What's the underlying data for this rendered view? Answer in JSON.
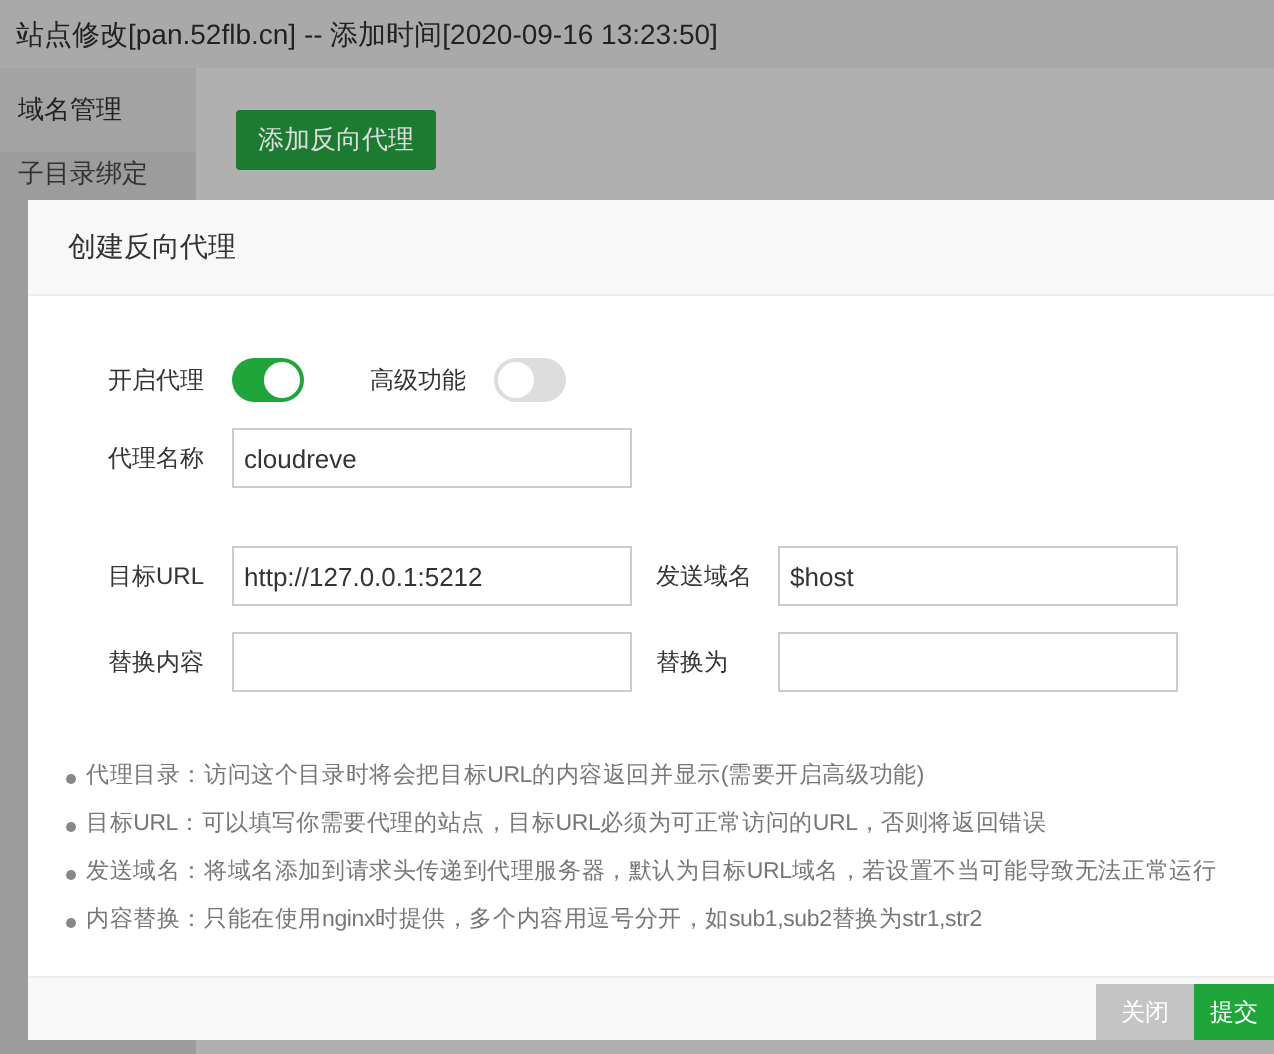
{
  "window": {
    "title": "站点修改[pan.52flb.cn] -- 添加时间[2020-09-16 13:23:50]"
  },
  "sidebar": {
    "items": [
      {
        "label": "域名管理",
        "selected": true
      },
      {
        "label": "子目录绑定",
        "selected": false
      }
    ]
  },
  "add_button": "添加反向代理",
  "dialog": {
    "title": "创建反向代理",
    "toggles": [
      {
        "label": "开启代理",
        "on": true
      },
      {
        "label": "高级功能",
        "on": false
      }
    ],
    "fields": [
      [
        {
          "label": "代理名称",
          "value": "cloudreve"
        }
      ],
      [
        {
          "label": "目标URL",
          "value": "http://127.0.0.1:5212"
        },
        {
          "label": "发送域名",
          "value": "$host"
        }
      ],
      [
        {
          "label": "替换内容"
        },
        {
          "label": "替换为"
        }
      ]
    ],
    "notes": [
      "代理目录：访问这个目录时将会把目标URL的内容返回并显示(需要开启高级功能)",
      "目标URL：可以填写你需要代理的站点，目标URL必须为可正常访问的URL，否则将返回错误",
      "发送域名：将域名添加到请求头传递到代理服务器，默认为目标URL域名，若设置不当可能导致无法正常运行",
      "内容替换：只能在使用nginx时提供，多个内容用逗号分开，如sub1,sub2替换为str1,str2"
    ],
    "buttons": [
      {
        "label": "关闭",
        "kind": "secondary"
      },
      {
        "label": "提交",
        "kind": "primary"
      }
    ]
  }
}
